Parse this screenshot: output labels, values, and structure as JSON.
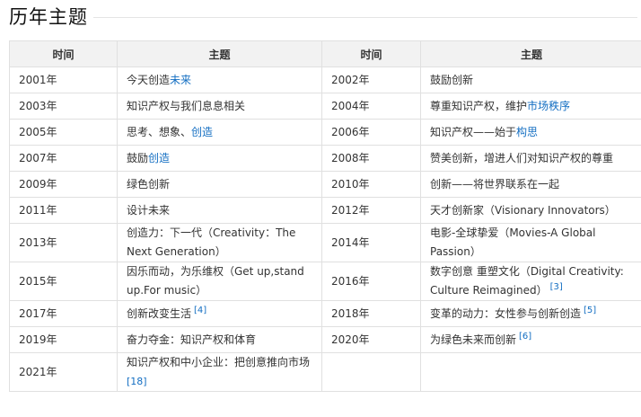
{
  "section": {
    "title": "历年主题"
  },
  "table": {
    "headers": [
      "时间",
      "主题",
      "时间",
      "主题"
    ],
    "rows": [
      {
        "y1": "2001年",
        "t1a": "今天创造",
        "t1b": "未来",
        "y2": "2002年",
        "t2": "鼓励创新"
      },
      {
        "y1": "2003年",
        "t1": "知识产权与我们息息相关",
        "y2": "2004年",
        "t2a": "尊重知识产权，维护",
        "t2b": "市场秩序"
      },
      {
        "y1": "2005年",
        "t1a": "思考、想象、",
        "t1b": "创造",
        "y2": "2006年",
        "t2a": "知识产权——始于",
        "t2b": "构思"
      },
      {
        "y1": "2007年",
        "t1a": "鼓励",
        "t1b": "创造",
        "y2": "2008年",
        "t2": "赞美创新，增进人们对知识产权的尊重"
      },
      {
        "y1": "2009年",
        "t1": "绿色创新",
        "y2": "2010年",
        "t2": "创新——将世界联系在一起"
      },
      {
        "y1": "2011年",
        "t1": "设计未来",
        "y2": "2012年",
        "t2": "天才创新家（Visionary Innovators）"
      },
      {
        "y1": "2013年",
        "t1": "创造力：下一代（Creativity：The Next Generation）",
        "y2": "2014年",
        "t2": "电影-全球挚爱（Movies-A Global Passion）"
      },
      {
        "y1": "2015年",
        "t1": "因乐而动，为乐维权（Get up,stand up.For music）",
        "y2": "2016年",
        "t2": "数字创意 重塑文化（Digital Creativity: Culture Reimagined）",
        "t2ref": "[3]"
      },
      {
        "y1": "2017年",
        "t1": "创新改变生活",
        "t1ref": "[4]",
        "y2": "2018年",
        "t2": "变革的动力：女性参与创新创造",
        "t2ref": "[5]"
      },
      {
        "y1": "2019年",
        "t1": "奋力夺金：知识产权和体育",
        "y2": "2020年",
        "t2": "为绿色未来而创新",
        "t2ref": "[6]"
      },
      {
        "y1": "2021年",
        "t1": "知识产权和中小企业：把创意推向市场",
        "t1ref": "[18]",
        "y2": "",
        "t2": ""
      }
    ]
  }
}
